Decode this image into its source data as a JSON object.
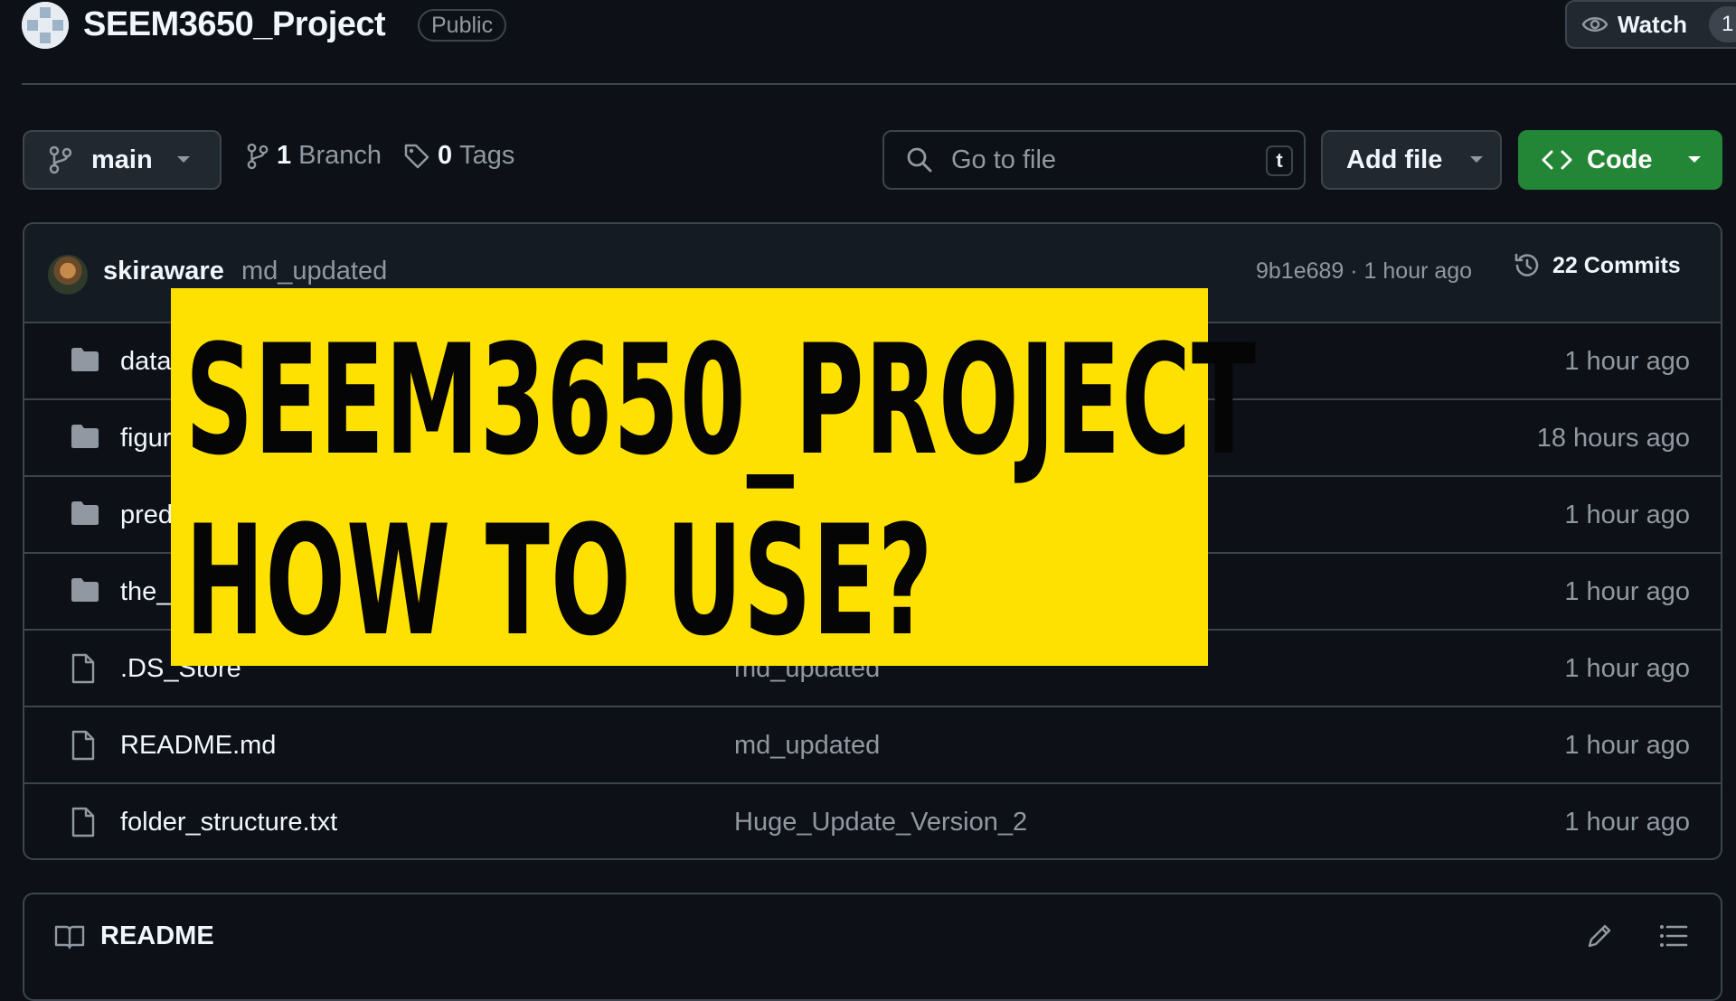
{
  "header": {
    "repo_name": "SEEM3650_Project",
    "visibility_badge": "Public",
    "watch_label": "Watch",
    "watch_count": "1"
  },
  "toolbar": {
    "branch_name": "main",
    "branch_count": "1",
    "branch_label": "Branch",
    "tag_count": "0",
    "tag_label": "Tags",
    "search_placeholder": "Go to file",
    "search_shortcut": "t",
    "add_file_label": "Add file",
    "code_label": "Code",
    "code_button_color": "#238636"
  },
  "latest_commit": {
    "author": "skiraware",
    "message": "md_updated",
    "hash_time": "9b1e689 · 1 hour ago",
    "commits_label": "22 Commits"
  },
  "files": [
    {
      "type": "folder-icon",
      "name": "data",
      "message": "",
      "time": "1 hour ago"
    },
    {
      "type": "folder-icon",
      "name": "figur",
      "message": "",
      "time": "18 hours ago"
    },
    {
      "type": "folder-icon",
      "name": "pred",
      "message": "",
      "time": "1 hour ago"
    },
    {
      "type": "folder-icon",
      "name": "the_",
      "message": "",
      "time": "1 hour ago"
    },
    {
      "type": "file-icon",
      "name": ".DS_Store",
      "message": "md_updated",
      "time": "1 hour ago"
    },
    {
      "type": "file-icon",
      "name": "README.md",
      "message": "md_updated",
      "time": "1 hour ago"
    },
    {
      "type": "file-icon",
      "name": "folder_structure.txt",
      "message": "Huge_Update_Version_2",
      "time": "1 hour ago"
    }
  ],
  "readme": {
    "title": "README"
  },
  "overlay": {
    "line1": "SEEM3650_PROJECT",
    "line2": "HOW TO USE?",
    "background_color": "#ffe100"
  }
}
